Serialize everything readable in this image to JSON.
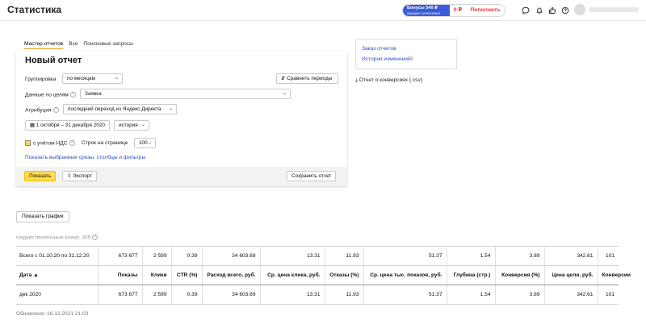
{
  "header": {
    "title": "Статистика",
    "bonus_label": "Бонусы 540 ₽",
    "bonus_sub": "ожидают зачисления",
    "balance": "0 ₽",
    "topup_label": "Пополнить",
    "icons": [
      "chat-icon",
      "bell-icon",
      "thumb-up-icon",
      "question-icon"
    ]
  },
  "tabs": [
    {
      "label": "Мастер отчетов",
      "active": true
    },
    {
      "label": "Все",
      "active": false
    },
    {
      "label": "Поисковые запросы",
      "active": false
    }
  ],
  "report": {
    "title": "Новый отчет",
    "grouping_label": "Группировка",
    "grouping_value": "по месяцам",
    "compare_label": "Сравнить периоды",
    "goals_label": "Данные по целям",
    "goals_value": "Заявка",
    "attribution_label": "Атрибуция",
    "attribution_value": "последний переход из Яндекс.Директа",
    "period_value": "1 октября – 31 декабря 2020",
    "history_value": "история",
    "vat_label": "с учётом НДС",
    "rows_label": "Строк на странице",
    "rows_value": "100",
    "show_selected_link": "Показать выбранные срезы, столбцы и фильтры",
    "show_button": "Показать",
    "export_button": "Экспорт",
    "save_button": "Сохранить отчет"
  },
  "side": {
    "order_reports": "Заказ отчетов",
    "history": "История изменений",
    "csv_report": "Отчет о конверсиях (.csv)"
  },
  "show_graph_button": "Показать график",
  "invalid_clicks": "Недействительные клики: 305",
  "table": {
    "totals_label": "Всего с 01.10.20 по 31.12.20",
    "totals": [
      "673 677",
      "2 599",
      "0.39",
      "34 603.69",
      "13.31",
      "11.93",
      "51.37",
      "1.54",
      "3.89",
      "342.61",
      "101"
    ],
    "columns": [
      "Дата ▲",
      "Показы",
      "Клики",
      "CTR (%)",
      "Расход всего, руб.",
      "Ср. цена клика, руб.",
      "Отказы (%)",
      "Ср. цена тыс. показов, руб.",
      "Глубина (стр.)",
      "Конверсия (%)",
      "Цена цели, руб.",
      "Конверсии"
    ],
    "rows": [
      [
        "дек 2020",
        "673 677",
        "2 599",
        "0.39",
        "34 603.69",
        "13.31",
        "11.93",
        "51.37",
        "1.54",
        "3.89",
        "342.61",
        "101"
      ]
    ]
  },
  "updated": "Обновлено: 16.12.2021 21:03"
}
